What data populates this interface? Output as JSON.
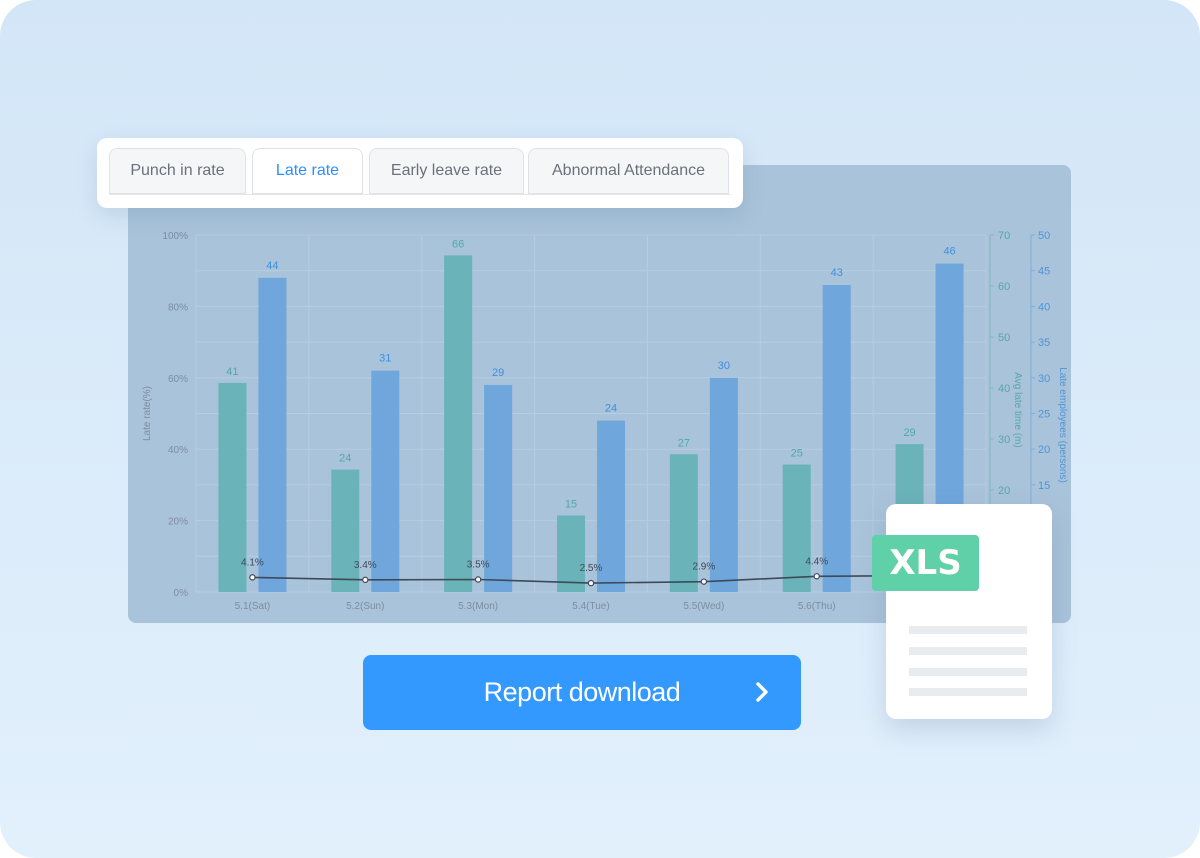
{
  "tabs": [
    {
      "label": "Punch in rate",
      "active": false
    },
    {
      "label": "Late rate",
      "active": true
    },
    {
      "label": "Early leave rate",
      "active": false
    },
    {
      "label": "Abnormal Attendance",
      "active": false
    }
  ],
  "download": {
    "label": "Report download",
    "icon": "chevron-right-icon"
  },
  "file_badge": {
    "label": "XLS",
    "icon": "spreadsheet-file-icon"
  },
  "colors": {
    "avg_late_bar": "#6ab3b8",
    "late_emp_bar": "#6fa6dc",
    "rate_line": "#3d4a5a",
    "button": "#3399ff",
    "badge": "#5fd0a7"
  },
  "chart_data": {
    "type": "bar",
    "categories": [
      "5.1(Sat)",
      "5.2(Sun)",
      "5.3(Mon)",
      "5.4(Tue)",
      "5.5(Wed)",
      "5.6(Thu)",
      ""
    ],
    "series": [
      {
        "axis": "right1",
        "values": [
          41,
          24,
          66,
          15,
          27,
          25,
          29
        ]
      },
      {
        "axis": "right2",
        "values": [
          44,
          31,
          29,
          24,
          30,
          43,
          46
        ]
      },
      {
        "axis": "left",
        "type": "line",
        "values": [
          4.1,
          3.4,
          3.5,
          2.5,
          2.9,
          4.4,
          4.6
        ],
        "labels": [
          "4.1%",
          "3.4%",
          "3.5%",
          "2.5%",
          "2.9%",
          "4.4%",
          ""
        ]
      }
    ],
    "ylabel": "Late rate(%)",
    "y2label": "Avg late time (m)",
    "y3label": "Late employees (persons)",
    "y_ticks": [
      "0%",
      "20%",
      "40%",
      "60%",
      "80%",
      "100%"
    ],
    "y2_ticks": [
      "20",
      "30",
      "40",
      "50",
      "60",
      "70"
    ],
    "y3_ticks": [
      "15",
      "20",
      "25",
      "30",
      "35",
      "40",
      "45",
      "50"
    ],
    "ylim": [
      0,
      100
    ],
    "y2lim": [
      0,
      70
    ],
    "y3lim": [
      0,
      50
    ],
    "grid": true
  }
}
